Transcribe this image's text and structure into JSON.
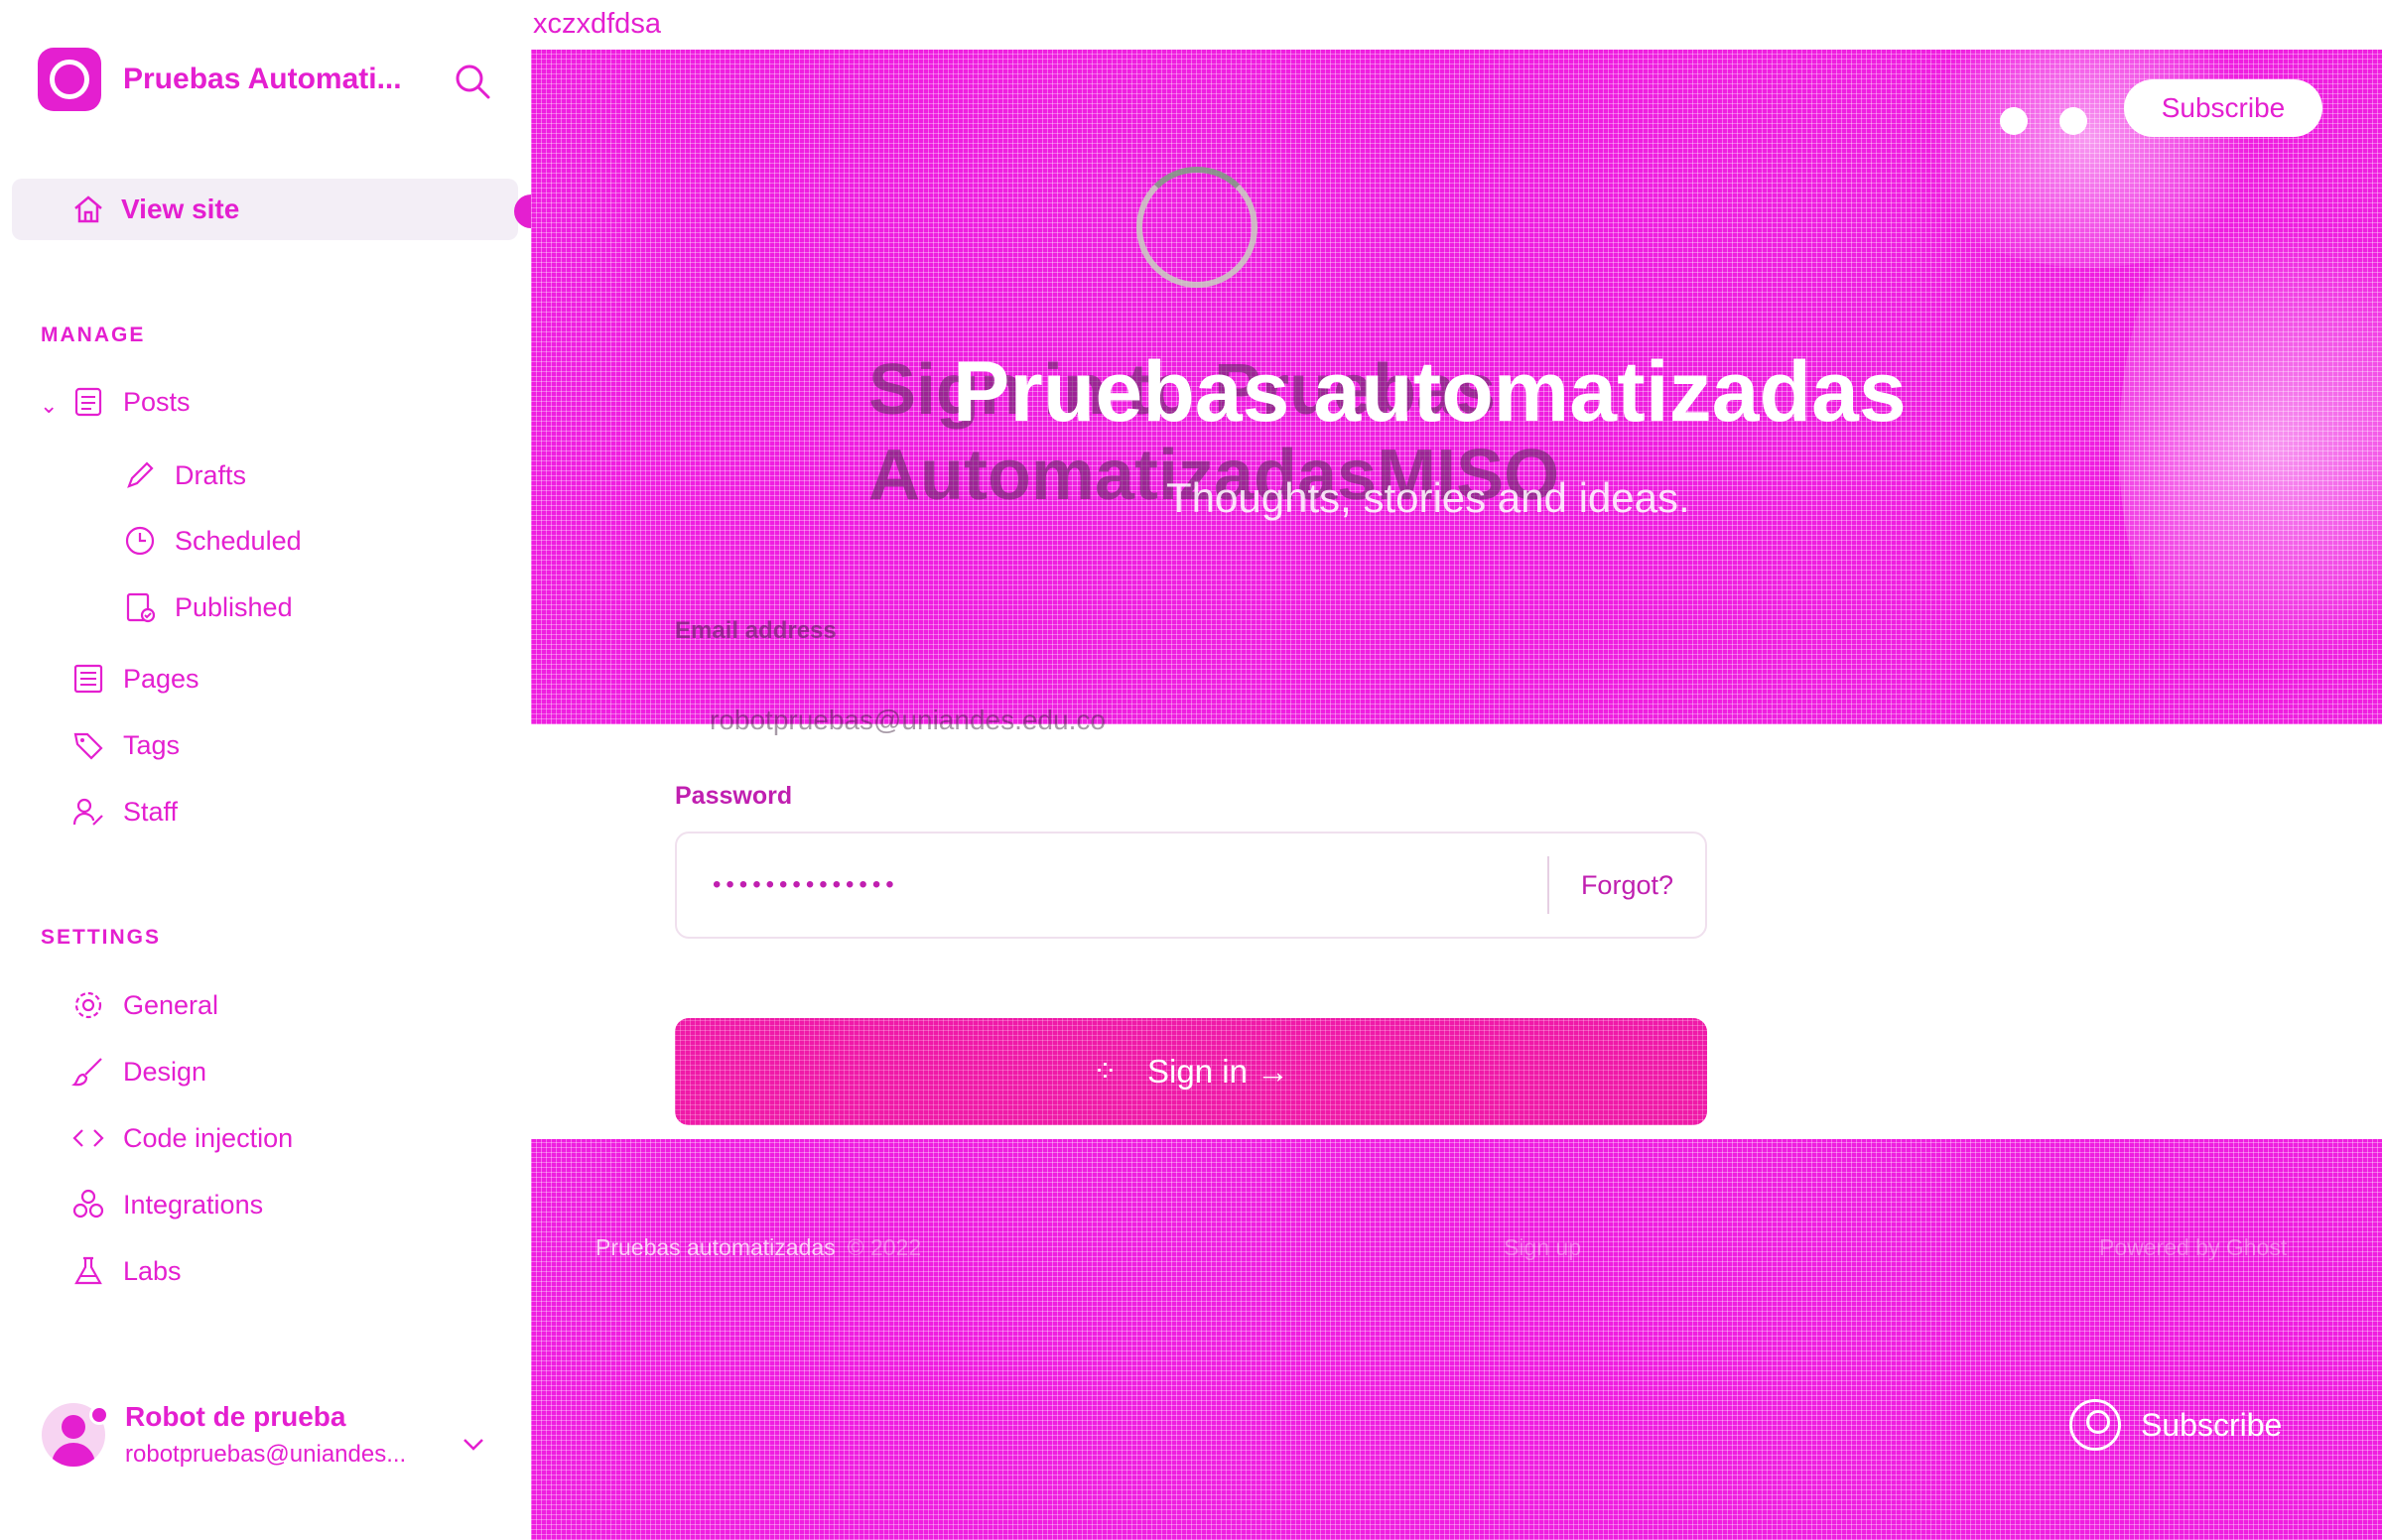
{
  "sidebar": {
    "brand_name": "Pruebas Automati...",
    "view_site": "View site",
    "manage_header": "MANAGE",
    "settings_header": "SETTINGS",
    "items": {
      "posts": "Posts",
      "drafts": "Drafts",
      "scheduled": "Scheduled",
      "published": "Published",
      "pages": "Pages",
      "tags": "Tags",
      "staff": "Staff",
      "general": "General",
      "design": "Design",
      "code_injection": "Code injection",
      "integrations": "Integrations",
      "labs": "Labs"
    },
    "user": {
      "name": "Robot de prueba",
      "email": "robotpruebas@uniandes..."
    }
  },
  "main": {
    "top_text": "xczxdfdsa",
    "hero": {
      "subscribe_label": "Subscribe",
      "signin_title": "Sign in to Pruebas AutomatizadasMISO",
      "site_title": "Pruebas automatizadas",
      "site_description": "Thoughts, stories and ideas.",
      "email_label": "Email address",
      "email_value": "robotpruebas@uniandes.edu.co"
    },
    "form": {
      "password_label": "Password",
      "password_value": "••••••••••••••",
      "forgot_label": "Forgot?",
      "signin_label": "Sign in →"
    },
    "footer": {
      "site": "Pruebas automatizadas",
      "year": "© 2022",
      "center": "Sign up",
      "powered": "Powered by Ghost",
      "subscribe_label": "Subscribe"
    }
  },
  "colors": {
    "accent": "#e41fd0",
    "hero_bg": "#ef1ee0",
    "button_bg": "#ef1aa8"
  }
}
